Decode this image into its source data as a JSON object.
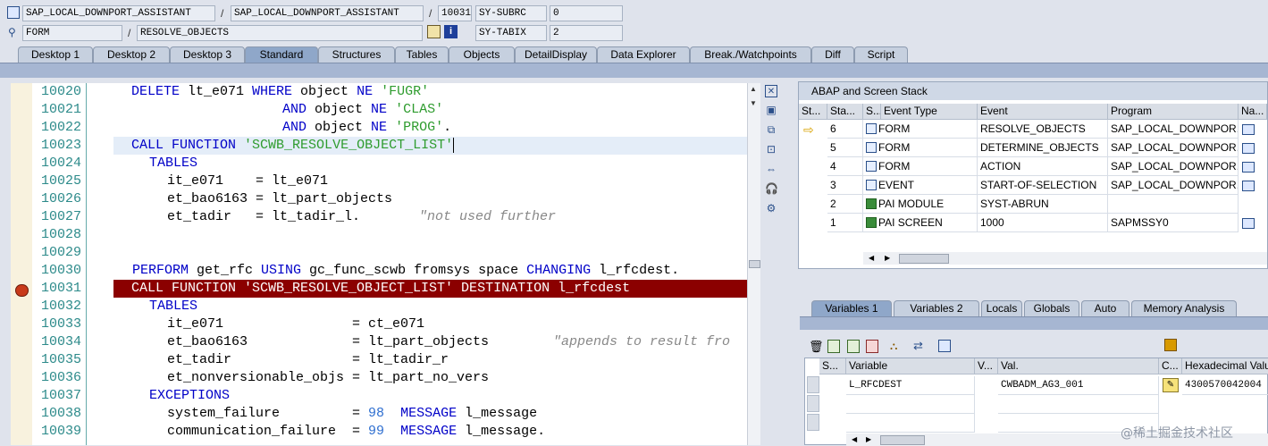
{
  "header": {
    "row1": {
      "program1": "SAP_LOCAL_DOWNPORT_ASSISTANT",
      "program2": "SAP_LOCAL_DOWNPORT_ASSISTANT",
      "line": "10031",
      "sysfield": "SY-SUBRC",
      "sysvalue": "0"
    },
    "row2": {
      "type": "FORM",
      "name": "RESOLVE_OBJECTS",
      "sysfield": "SY-TABIX",
      "sysvalue": "2"
    },
    "sep": "/"
  },
  "tabs": [
    "Desktop 1",
    "Desktop 2",
    "Desktop 3",
    "Standard",
    "Structures",
    "Tables",
    "Objects",
    "DetailDisplay",
    "Data Explorer",
    "Break./Watchpoints",
    "Diff",
    "Script"
  ],
  "active_tab": "Standard",
  "editor": {
    "lines": [
      {
        "no": "10020"
      },
      {
        "no": "10021"
      },
      {
        "no": "10022"
      },
      {
        "no": "10023"
      },
      {
        "no": "10024"
      },
      {
        "no": "10025"
      },
      {
        "no": "10026"
      },
      {
        "no": "10027"
      },
      {
        "no": "10028"
      },
      {
        "no": "10029"
      },
      {
        "no": "10030"
      },
      {
        "no": "10031"
      },
      {
        "no": "10032"
      },
      {
        "no": "10033"
      },
      {
        "no": "10034"
      },
      {
        "no": "10035"
      },
      {
        "no": "10036"
      },
      {
        "no": "10037"
      },
      {
        "no": "10038"
      },
      {
        "no": "10039"
      }
    ],
    "code": {
      "l0a": "DELETE",
      "l0b": " lt_e071 ",
      "l0c": "WHERE",
      "l0d": " object ",
      "l0e": "NE",
      "l0f": " ",
      "l0g": "'FUGR'",
      "l1a": "AND",
      "l1b": " object ",
      "l1c": "NE",
      "l1d": " ",
      "l1e": "'CLAS'",
      "l2a": "AND",
      "l2b": " object ",
      "l2c": "NE",
      "l2d": " ",
      "l2e": "'PROG'",
      "l2f": ".",
      "l3a": "CALL FUNCTION",
      "l3b": " ",
      "l3c": "'SCWB_RESOLVE_OBJECT_LIST'",
      "l4a": "TABLES",
      "l5a": "it_e071    = lt_e071",
      "l6a": "et_bao6163 = lt_part_objects",
      "l7a": "et_tadir   = lt_tadir_l.",
      "l7b": "\"not used further",
      "l10a": "PERFORM",
      "l10b": " get_rfc ",
      "l10c": "USING",
      "l10d": " gc_func_scwb fromsys space ",
      "l10e": "CHANGING",
      "l10f": " l_rfcdest.",
      "l11a": "CALL FUNCTION 'SCWB_RESOLVE_OBJECT_LIST' DESTINATION l_rfcdest",
      "l12a": "TABLES",
      "l13a": "it_e071                = ct_e071",
      "l14a": "et_bao6163             = lt_part_objects",
      "l14b": "\"appends to result fro",
      "l15a": "et_tadir               = lt_tadir_r",
      "l16a": "et_nonversionable_objs = lt_part_no_vers",
      "l17a": "EXCEPTIONS",
      "l18a": "system_failure         = ",
      "l18b": "98",
      "l18c": "  ",
      "l18d": "MESSAGE",
      "l18e": " l_message",
      "l19a": "communication_failure  = ",
      "l19b": "99",
      "l19c": "  ",
      "l19d": "MESSAGE",
      "l19e": " l_message."
    }
  },
  "stack": {
    "title": "ABAP and Screen Stack",
    "columns": [
      "St...",
      "Sta...",
      "S...",
      "Event Type",
      "Event",
      "Program",
      "Na..."
    ],
    "rows": [
      {
        "level": "6",
        "type": "FORM",
        "event": "RESOLVE_OBJECTS",
        "program": "SAP_LOCAL_DOWNPOR..."
      },
      {
        "level": "5",
        "type": "FORM",
        "event": "DETERMINE_OBJECTS",
        "program": "SAP_LOCAL_DOWNPOR..."
      },
      {
        "level": "4",
        "type": "FORM",
        "event": "ACTION",
        "program": "SAP_LOCAL_DOWNPOR..."
      },
      {
        "level": "3",
        "type": "EVENT",
        "event": "START-OF-SELECTION",
        "program": "SAP_LOCAL_DOWNPOR..."
      },
      {
        "level": "2",
        "type": "PAI MODULE",
        "event": "SYST-ABRUN",
        "program": ""
      },
      {
        "level": "1",
        "type": "PAI SCREEN",
        "event": "1000",
        "program": "SAPMSSY0"
      }
    ]
  },
  "var_tabs": [
    "Variables 1",
    "Variables 2",
    "Locals",
    "Globals",
    "Auto",
    "Memory Analysis"
  ],
  "variables": {
    "columns": [
      "S...",
      "Variable",
      "V...",
      "Val.",
      "C...",
      "Hexadecimal Valu"
    ],
    "rows": [
      {
        "name": "L_RFCDEST",
        "value": "CWBADM_AG3_001",
        "hex": "4300570042004"
      }
    ]
  },
  "icons": {
    "stack_arrow": "current-position-arrow-icon",
    "breakpoint": "breakpoint-icon"
  },
  "colors": {
    "breakpoint_line": "#8b0000",
    "keyword": "#0000c8",
    "string": "#2f9c2f",
    "comment": "#888888"
  },
  "watermark": "@稀土掘金技术社区"
}
